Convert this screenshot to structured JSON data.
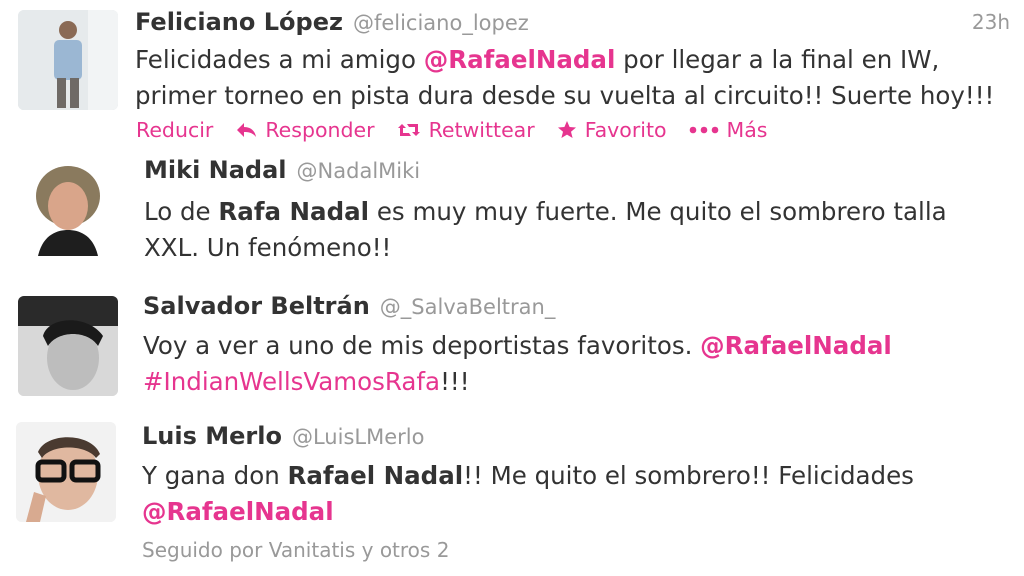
{
  "tweets": [
    {
      "name": "Feliciano López",
      "handle": "@feliciano_lopez",
      "time": "23h",
      "line1_a": "Felicidades a mi amigo ",
      "line1_mention": "@RafaelNadal",
      "line1_b": " por llegar a la final en IW,",
      "line2": "primer torneo en pista dura desde su vuelta al circuito!! Suerte hoy!!!",
      "actions": {
        "collapse": "Reducir",
        "reply": "Responder",
        "retweet": "Retwittear",
        "favorite": "Favorito",
        "more": "Más"
      }
    },
    {
      "name": "Miki Nadal",
      "handle": "@NadalMiki",
      "line1_a": "Lo de ",
      "line1_bold": "Rafa Nadal",
      "line1_b": " es muy muy fuerte. Me quito el sombrero talla",
      "line2": "XXL. Un fenómeno!!"
    },
    {
      "name": "Salvador Beltrán",
      "handle": "@_SalvaBeltran_",
      "line1_a": "Voy a ver a uno de mis deportistas favoritos. ",
      "line1_mention": "@RafaelNadal",
      "line2_hashtag": "#IndianWellsVamosRafa",
      "line2_b": "!!!"
    },
    {
      "name": "Luis Merlo",
      "handle": "@LuisLMerlo",
      "line1_a": "Y gana don ",
      "line1_bold": "Rafael Nadal",
      "line1_b": "!! Me quito el sombrero!! Felicidades",
      "line2_mention": "@RafaelNadal",
      "followed_by": "Seguido por Vanitatis y otros 2"
    }
  ],
  "colors": {
    "accent": "#e6358f",
    "muted": "#999999",
    "text": "#333333"
  }
}
